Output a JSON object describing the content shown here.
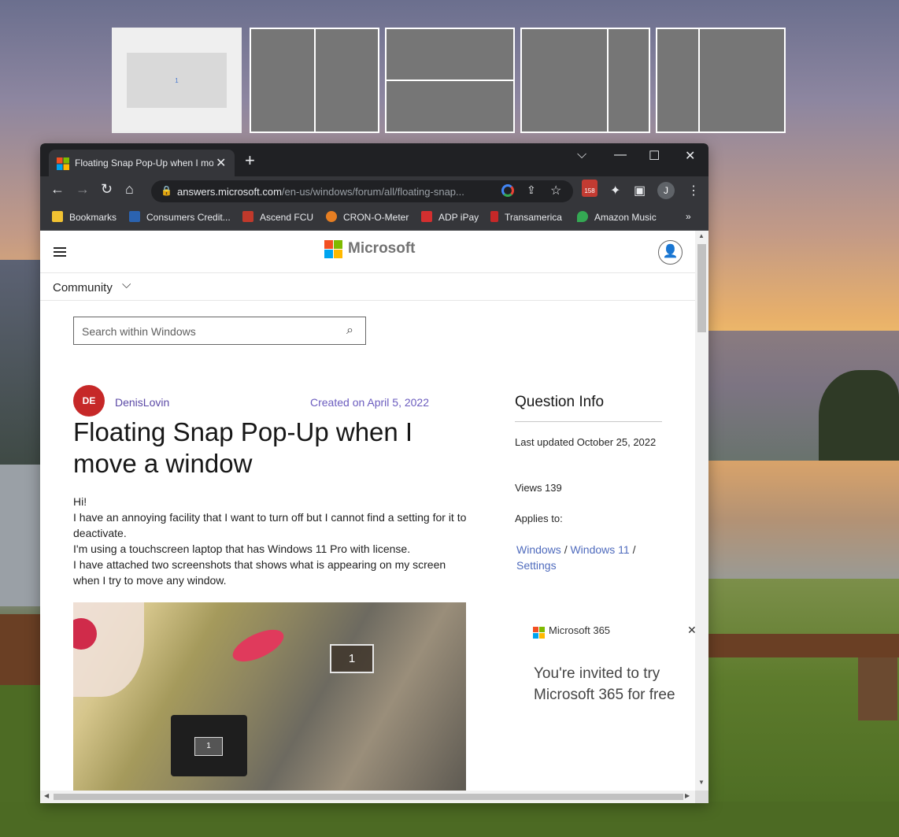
{
  "snap_layouts": {
    "first_zone_label": "1"
  },
  "browser": {
    "tab_title": "Floating Snap Pop-Up when I move a window",
    "new_tab_symbol": "+",
    "url_domain": "answers.microsoft.com",
    "url_path": "/en-us/windows/forum/all/floating-snap...",
    "ext_badge_count": "158",
    "profile_initial": "J",
    "bookmarks": [
      {
        "label": "Bookmarks",
        "icon": "folder-icon",
        "color": "#f1c232"
      },
      {
        "label": "Consumers Credit...",
        "icon": "shield-icon",
        "color": "#2b63b0"
      },
      {
        "label": "Ascend FCU",
        "icon": "ascend-icon",
        "color": "#c0392b"
      },
      {
        "label": "CRON-O-Meter",
        "icon": "cronometer-icon",
        "color": "#e67e22"
      },
      {
        "label": "ADP iPay",
        "icon": "adp-icon",
        "color": "#d32f2f"
      },
      {
        "label": "Transamerica",
        "icon": "transamerica-icon",
        "color": "#c62828"
      },
      {
        "label": "Amazon Music",
        "icon": "map-pin-icon",
        "color": "#34a853"
      }
    ],
    "more_bookmarks": "»"
  },
  "page": {
    "brand": "Microsoft",
    "nav_label": "Community",
    "search_placeholder": "Search within Windows",
    "author_initials": "DE",
    "author_name": "DenisLovin",
    "created": "Created on April 5, 2022",
    "title": "Floating Snap Pop-Up when I move a window",
    "body_lines": [
      "Hi!",
      "I have an annoying facility that I want to turn off but I cannot find a setting for it to deactivate.",
      "I'm using a touchscreen laptop that has Windows 11 Pro with license.",
      "I have attached two screenshots that shows what is appearing on my screen when I try to move any window."
    ],
    "image_snap_label": "1",
    "image_flyout_label": "1",
    "question_info": {
      "heading": "Question Info",
      "last_updated": "Last updated October 25, 2022",
      "views": "Views 139",
      "applies_to": "Applies to:",
      "crumb1": "Windows",
      "crumb2": "Windows 11",
      "crumb3": "Settings",
      "sep": "/"
    },
    "ad": {
      "brand": "Microsoft 365",
      "message": "You're invited to try Microsoft 365 for free"
    }
  },
  "colors": {
    "chrome_dark": "#202124",
    "chrome_tab": "#35363a",
    "link_purple": "#5b49a6",
    "author_red": "#c62828"
  }
}
